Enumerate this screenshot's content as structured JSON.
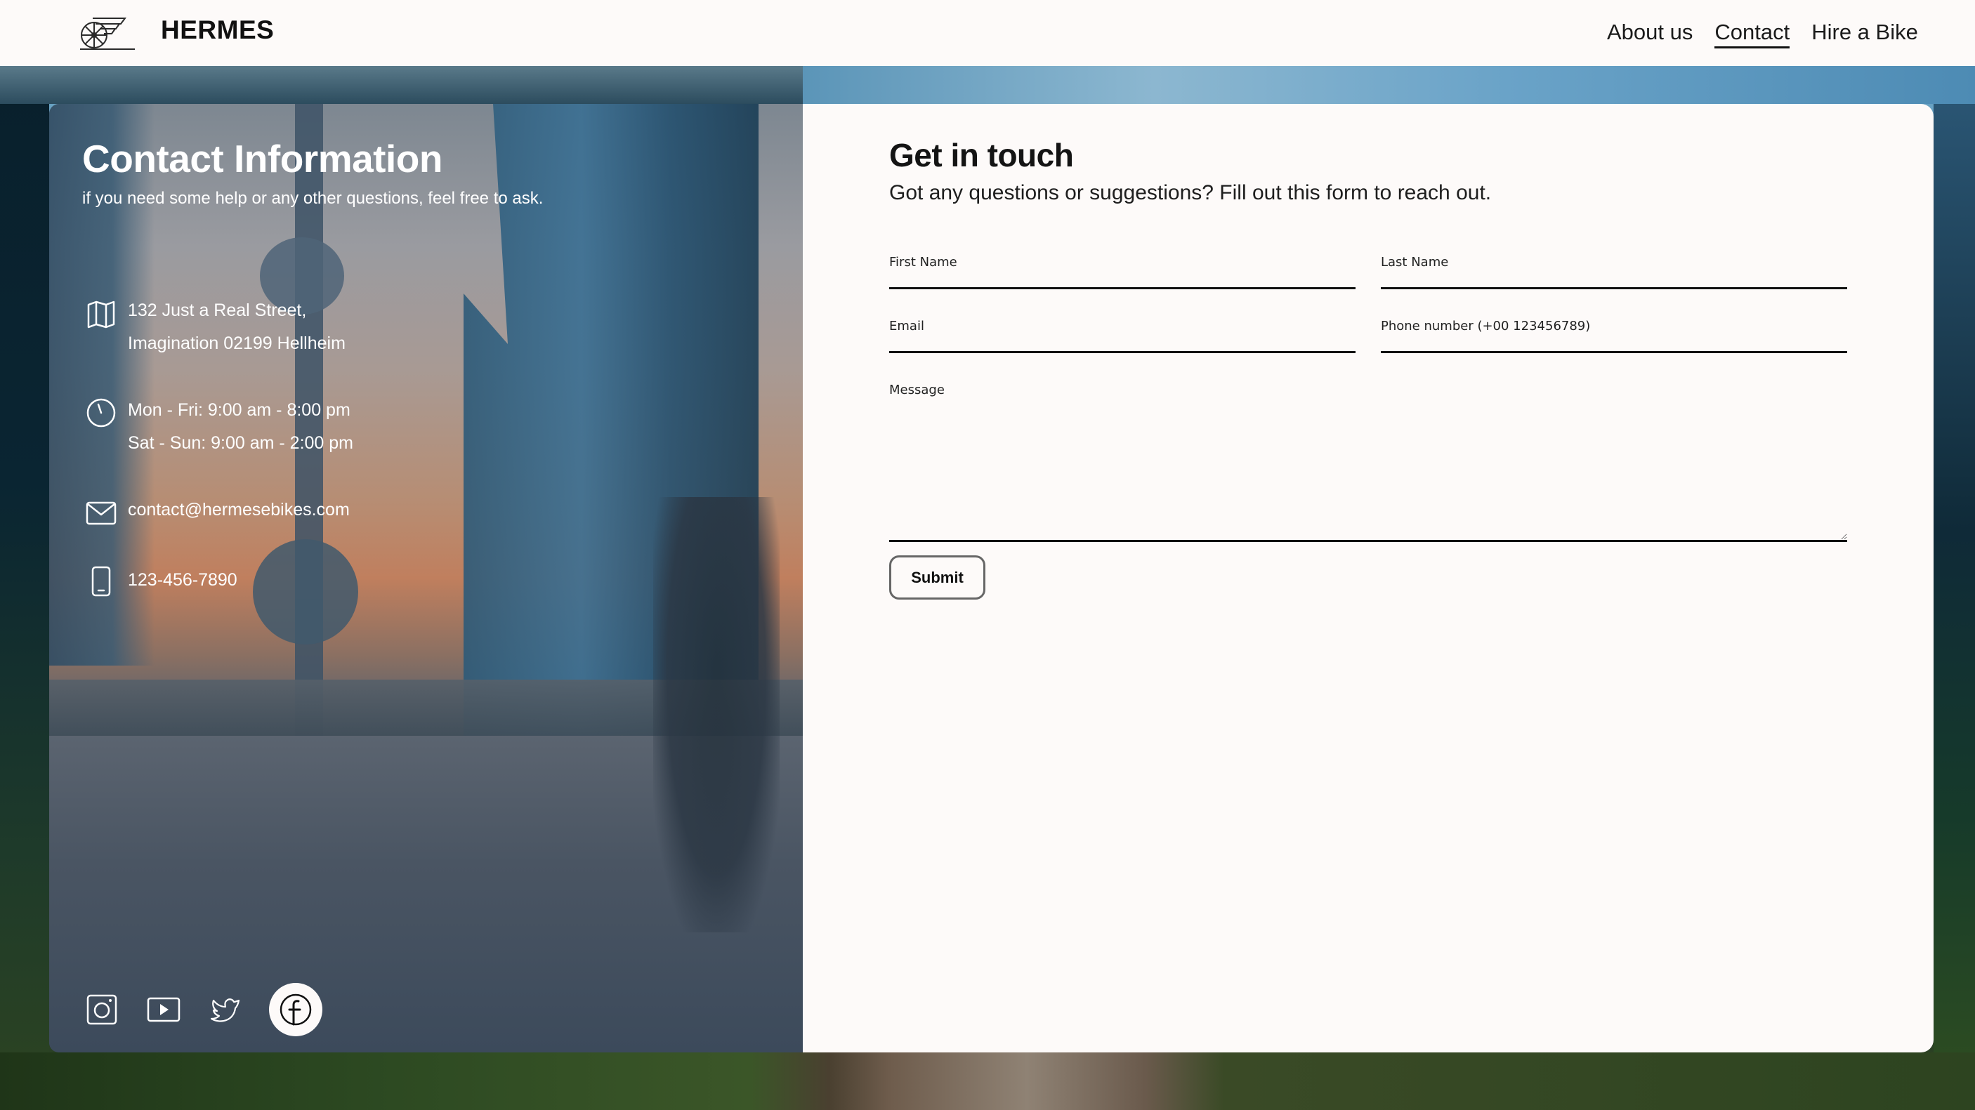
{
  "header": {
    "brand": "HERMES",
    "logo_icon": "winged-wheel-logo-icon",
    "nav": [
      {
        "label": "About us",
        "active": false
      },
      {
        "label": "Contact",
        "active": true
      },
      {
        "label": "Hire a Bike",
        "active": false
      }
    ]
  },
  "contact_info": {
    "title": "Contact Information",
    "subtitle": "if you need some help or any other questions, feel free to ask.",
    "address": {
      "icon": "map-icon",
      "lines": [
        "132 Just a Real Street,",
        "Imagination 02199 Hellheim"
      ]
    },
    "hours": {
      "icon": "clock-icon",
      "lines": [
        "Mon - Fri: 9:00 am - 8:00 pm",
        "Sat - Sun: 9:00 am - 2:00 pm"
      ]
    },
    "email": {
      "icon": "envelope-icon",
      "value": "contact@hermesebikes.com"
    },
    "phone": {
      "icon": "phone-icon",
      "value": "123-456-7890"
    },
    "socials": [
      {
        "name": "instagram",
        "icon": "instagram-icon"
      },
      {
        "name": "youtube",
        "icon": "youtube-icon"
      },
      {
        "name": "twitter",
        "icon": "twitter-icon"
      },
      {
        "name": "facebook",
        "icon": "facebook-icon",
        "highlighted": true
      }
    ]
  },
  "form": {
    "title": "Get in touch",
    "subtitle": "Got any questions or suggestions? Fill out this form to reach out.",
    "fields": {
      "first_name": {
        "label": "First Name",
        "value": ""
      },
      "last_name": {
        "label": "Last Name",
        "value": ""
      },
      "email": {
        "label": "Email",
        "value": ""
      },
      "phone": {
        "label": "Phone number (+00 123456789)",
        "value": ""
      },
      "message": {
        "label": "Message",
        "value": ""
      }
    },
    "submit_label": "Submit"
  }
}
